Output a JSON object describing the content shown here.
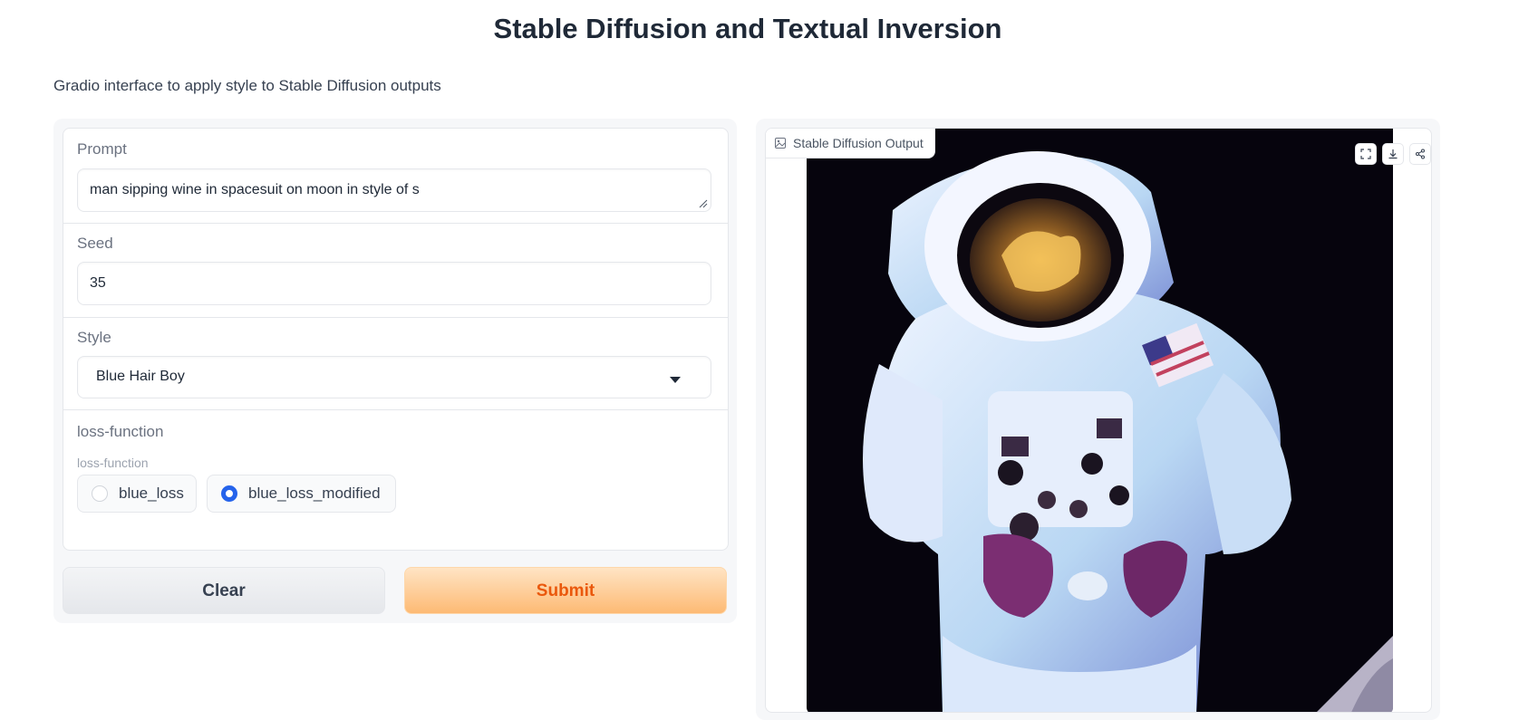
{
  "header": {
    "title": "Stable Diffusion and Textual Inversion",
    "subtitle": "Gradio interface to apply style to Stable Diffusion outputs"
  },
  "form": {
    "prompt": {
      "label": "Prompt",
      "value": "man sipping wine in spacesuit on moon in style of s"
    },
    "seed": {
      "label": "Seed",
      "value": "35"
    },
    "style": {
      "label": "Style",
      "selected": "Blue Hair Boy"
    },
    "loss_function": {
      "label": "loss-function",
      "info": "loss-function",
      "options": [
        {
          "label": "blue_loss",
          "checked": false
        },
        {
          "label": "blue_loss_modified",
          "checked": true
        }
      ]
    }
  },
  "buttons": {
    "clear": "Clear",
    "submit": "Submit"
  },
  "output": {
    "label": "Stable Diffusion Output",
    "icons": [
      "fullscreen-icon",
      "download-icon",
      "share-icon"
    ]
  },
  "colors": {
    "accent_blue": "#2563eb",
    "submit_text": "#ea580c",
    "submit_bg": "#fdba74"
  }
}
